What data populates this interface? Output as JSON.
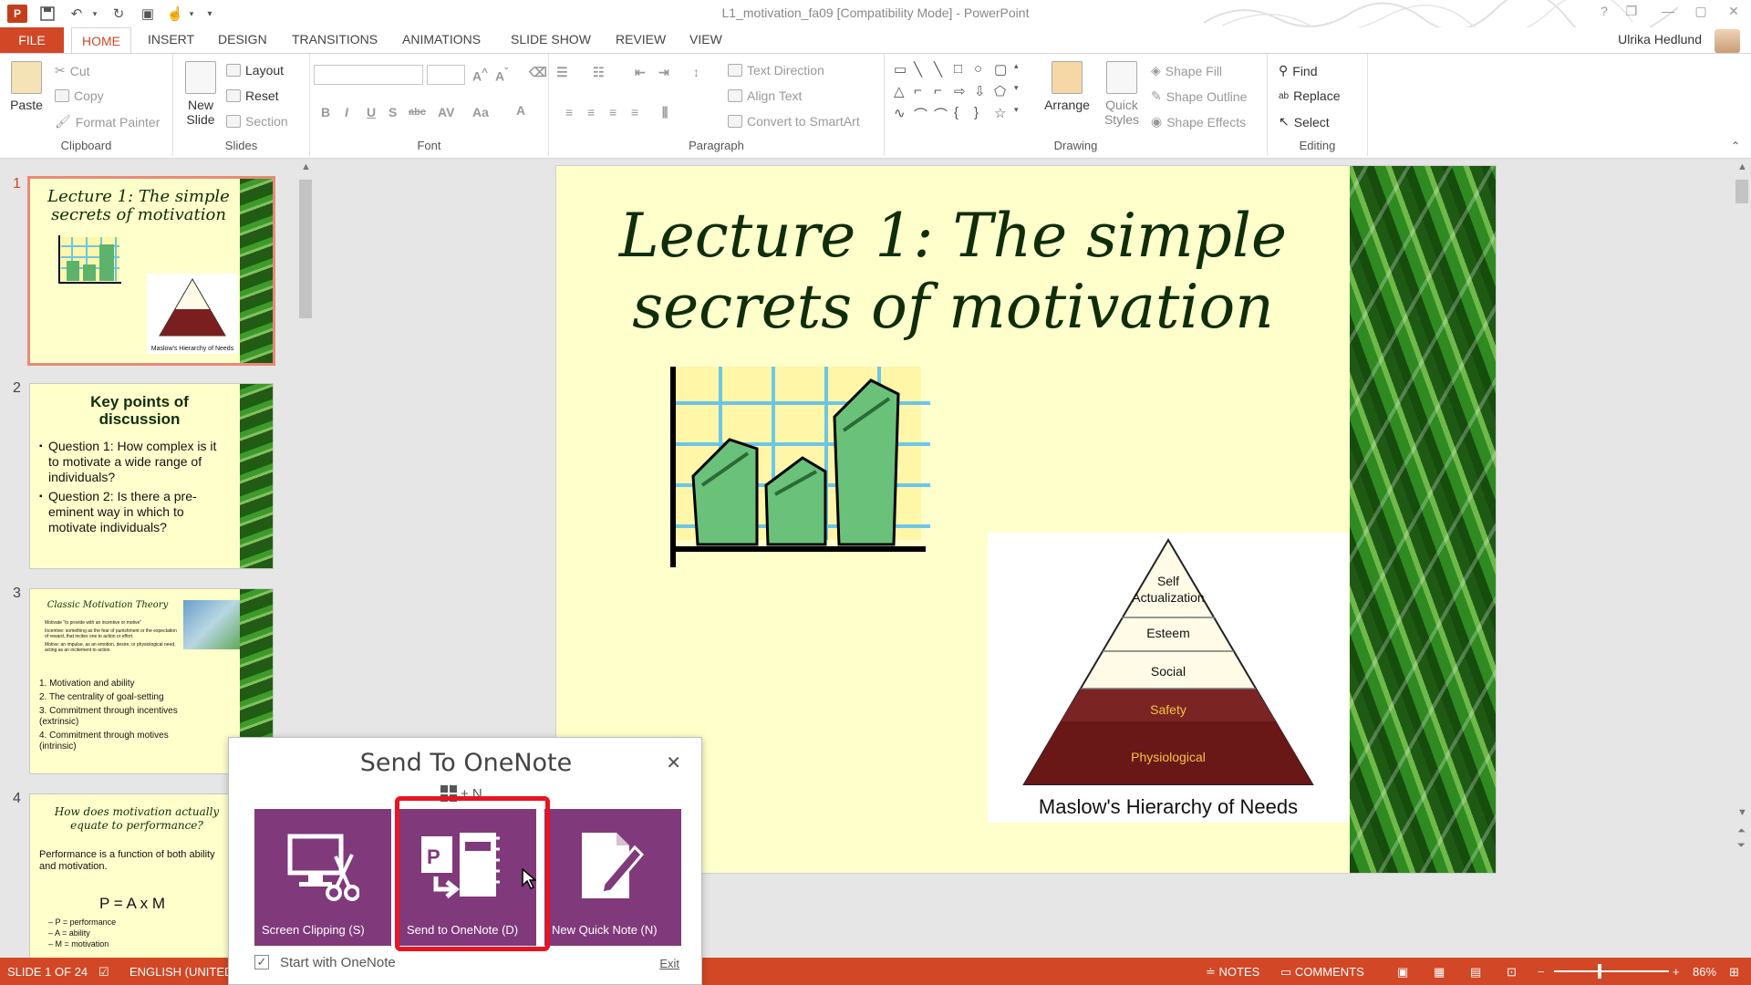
{
  "titlebar": {
    "app_icon": "P",
    "title": "L1_motivation_fa09 [Compatibility Mode] - PowerPoint",
    "controls": [
      "?",
      "❐",
      "—",
      "▢",
      "✕"
    ]
  },
  "tabs": {
    "file": "FILE",
    "items": [
      "HOME",
      "INSERT",
      "DESIGN",
      "TRANSITIONS",
      "ANIMATIONS",
      "SLIDE SHOW",
      "REVIEW",
      "VIEW"
    ],
    "user": "Ulrika Hedlund"
  },
  "ribbon": {
    "clipboard": {
      "label": "Clipboard",
      "paste": "Paste",
      "cut": "Cut",
      "copy": "Copy",
      "format_painter": "Format Painter"
    },
    "slides": {
      "label": "Slides",
      "new_slide": "New Slide",
      "layout": "Layout",
      "reset": "Reset",
      "section": "Section"
    },
    "font": {
      "label": "Font",
      "buttons": [
        "B",
        "I",
        "U",
        "S",
        "abc",
        "AV",
        "Aa",
        "A"
      ]
    },
    "paragraph": {
      "label": "Paragraph",
      "text_direction": "Text Direction",
      "align_text": "Align Text",
      "convert_smartart": "Convert to SmartArt"
    },
    "drawing": {
      "label": "Drawing",
      "arrange": "Arrange",
      "quick_styles": "Quick Styles",
      "shape_fill": "Shape Fill",
      "shape_outline": "Shape Outline",
      "shape_effects": "Shape Effects"
    },
    "editing": {
      "label": "Editing",
      "find": "Find",
      "replace": "Replace",
      "select": "Select"
    }
  },
  "thumbnails": [
    {
      "num": "1",
      "title": "Lecture 1: The simple secrets of motivation",
      "caption": "Maslow's Hierarchy of Needs"
    },
    {
      "num": "2",
      "title": "Key points of discussion",
      "bullets": [
        "Question 1: How complex is it to motivate a wide range of individuals?",
        "Question 2: Is there a pre-eminent way in which to motivate individuals?"
      ]
    },
    {
      "num": "3",
      "title": "Classic Motivation Theory",
      "small": [
        "Motivate \"to provide with an incentive or motive\"",
        "Incentive: something as the fear of punishment or the expectation of reward, that incites one to action or effort.",
        "Motive: an impulse, as an emotion, desire, or physiological need, acting as an incitement to action."
      ],
      "bullets": [
        "1. Motivation and ability",
        "2. The centrality of goal-setting",
        "3. Commitment through incentives (extrinsic)",
        "4. Commitment through motives (intrinsic)"
      ]
    },
    {
      "num": "4",
      "title": "How does motivation actually equate to performance?",
      "bullets": [
        "Performance is a function of both ability and motivation."
      ],
      "formula": "P = A x M",
      "defs": [
        "– P = performance",
        "– A = ability",
        "– M = motivation"
      ]
    }
  ],
  "slide": {
    "title_line1": "Lecture 1: The simple",
    "title_line2": "secrets of motivation",
    "pyramid": {
      "levels": [
        "Self Actualization",
        "Esteem",
        "Social",
        "Safety",
        "Physiological"
      ],
      "caption": "Maslow's Hierarchy of Needs"
    }
  },
  "statusbar": {
    "slide_info": "SLIDE 1 OF 24",
    "language": "ENGLISH (UNITED",
    "notes": "NOTES",
    "comments": "COMMENTS",
    "zoom": "86%"
  },
  "popup": {
    "title": "Send To OneNote",
    "shortcut": "+ N",
    "tiles": [
      {
        "label": "Screen Clipping (S)",
        "icon": "screen-clipping-icon"
      },
      {
        "label": "Send to OneNote (D)",
        "icon": "send-to-onenote-icon"
      },
      {
        "label": "New Quick Note (N)",
        "icon": "quick-note-icon"
      }
    ],
    "start_with": "Start with OneNote",
    "exit": "Exit"
  },
  "colors": {
    "accent": "#d24726",
    "onenote_purple": "#80397b",
    "highlight": "#e8141f",
    "slide_bg": "#ffffcc"
  }
}
